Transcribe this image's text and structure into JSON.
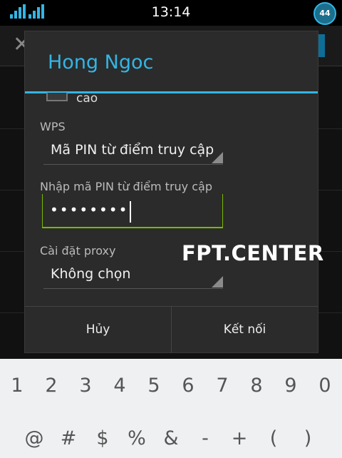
{
  "status_bar": {
    "time": "13:14",
    "battery": "44",
    "icons": [
      "signal-icon",
      "signal-icon",
      "battery-icon"
    ],
    "accent": "#33b5e5"
  },
  "dialog": {
    "title": "Hong Ngoc",
    "checkbox_label": "cao",
    "wps": {
      "label": "WPS",
      "value": "Mã PIN từ điểm truy cập"
    },
    "pin": {
      "label": "Nhập mã PIN từ điểm truy cập",
      "value": "••••••••"
    },
    "proxy": {
      "label": "Cài đặt proxy",
      "value": "Không chọn"
    },
    "buttons": {
      "cancel": "Hủy",
      "connect": "Kết nối"
    },
    "colors": {
      "title": "#33b5e5",
      "input_focus": "#7ab800"
    }
  },
  "watermark": "FPT.CENTER",
  "keyboard": {
    "row1": [
      "1",
      "2",
      "3",
      "4",
      "5",
      "6",
      "7",
      "8",
      "9",
      "0"
    ],
    "row2": [
      "@",
      "#",
      "$",
      "%",
      "&",
      "-",
      "+",
      "(",
      ")"
    ]
  }
}
